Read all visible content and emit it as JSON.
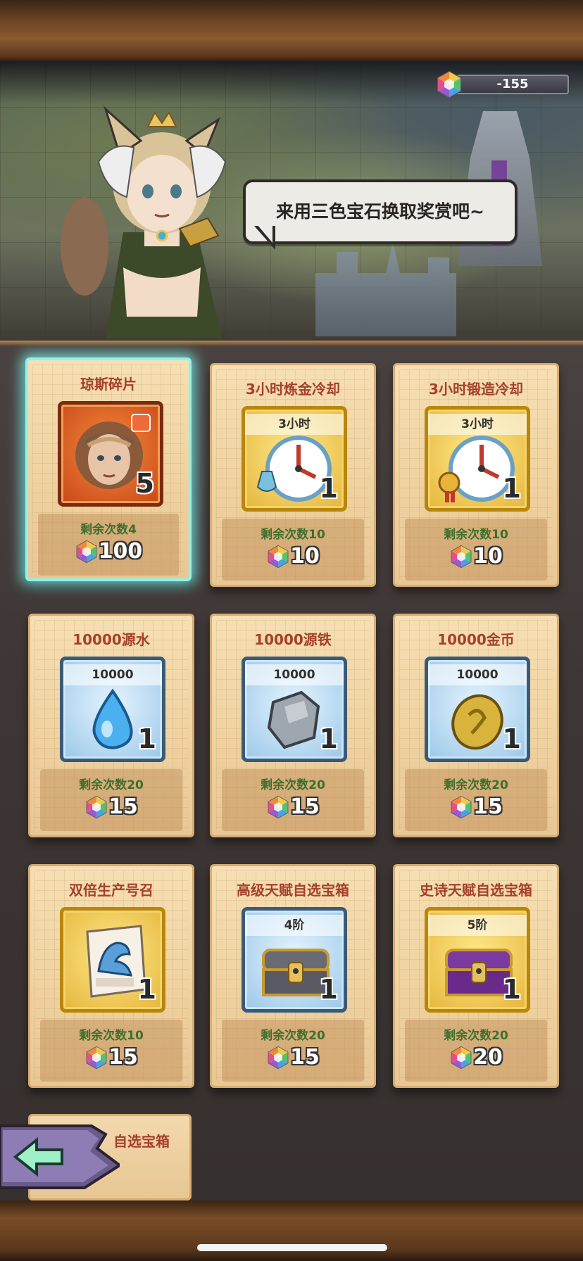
{
  "currency": {
    "amount": "-155",
    "icon": "tricolor-gem-icon"
  },
  "npc": {
    "speech": "来用三色宝石换取奖赏吧~"
  },
  "items": [
    {
      "title": "琼斯碎片",
      "icon": "jones-fragment-icon",
      "label": "",
      "count": "5",
      "remaining": "剩余次数4",
      "price": "100",
      "style": "orange",
      "selected": true
    },
    {
      "title": "3小时炼金冷却",
      "icon": "alchemy-clock-icon",
      "label": "3小时",
      "count": "1",
      "remaining": "剩余次数10",
      "price": "10",
      "style": "gold"
    },
    {
      "title": "3小时锻造冷却",
      "icon": "forge-clock-icon",
      "label": "3小时",
      "count": "1",
      "remaining": "剩余次数10",
      "price": "10",
      "style": "gold"
    },
    {
      "title": "10000源水",
      "icon": "water-drop-icon",
      "label": "10000",
      "count": "1",
      "remaining": "剩余次数20",
      "price": "15",
      "style": "blue"
    },
    {
      "title": "10000源铁",
      "icon": "iron-ore-icon",
      "label": "10000",
      "count": "1",
      "remaining": "剩余次数20",
      "price": "15",
      "style": "blue"
    },
    {
      "title": "10000金币",
      "icon": "gold-coin-icon",
      "label": "10000",
      "count": "1",
      "remaining": "剩余次数20",
      "price": "15",
      "style": "blue"
    },
    {
      "title": "双倍生产号召",
      "icon": "double-production-poster-icon",
      "label": "",
      "count": "1",
      "remaining": "剩余次数10",
      "price": "15",
      "style": "gold"
    },
    {
      "title": "高级天赋自选宝箱",
      "icon": "silver-chest-icon",
      "label": "4阶",
      "count": "1",
      "remaining": "剩余次数20",
      "price": "15",
      "style": "blue"
    },
    {
      "title": "史诗天赋自选宝箱",
      "icon": "purple-chest-icon",
      "label": "5阶",
      "count": "1",
      "remaining": "剩余次数20",
      "price": "20",
      "style": "gold"
    }
  ],
  "partial_item": {
    "title": "自选宝箱"
  },
  "back": {
    "icon": "back-arrow-icon"
  },
  "colors": {
    "title_red": "#a5402a",
    "remaining_green": "#3e6e2c",
    "selection_glow": "#8ff3ea"
  }
}
